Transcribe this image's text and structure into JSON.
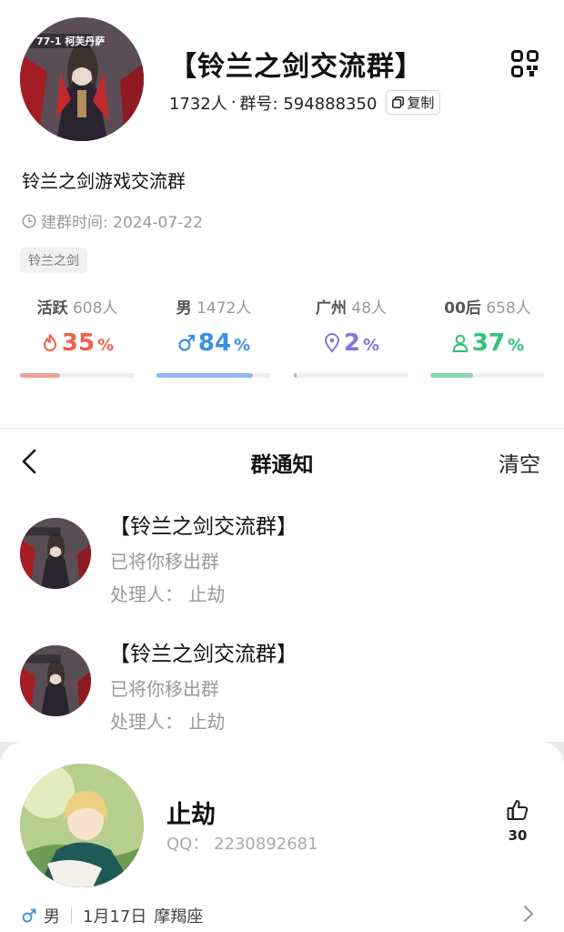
{
  "group": {
    "name": "【铃兰之剑交流群】",
    "member_count": "1732人",
    "separator": "·",
    "group_id_label": "群号: 594888350",
    "copy_label": "复制",
    "description": "铃兰之剑游戏交流群",
    "created_label": "建群时间: 2024-07-22",
    "tag": "铃兰之剑",
    "avatar_caption": "77-1 柯芙丹萨"
  },
  "stats": [
    {
      "name": "活跃",
      "count": "608人",
      "value": "35",
      "unit": "%",
      "fill": 0.35,
      "color": "#f0614c",
      "icon": "flame-icon"
    },
    {
      "name": "男",
      "count": "1472人",
      "value": "84",
      "unit": "%",
      "fill": 0.84,
      "color": "#3a8ee6",
      "icon": "male-icon"
    },
    {
      "name": "广州",
      "count": "48人",
      "value": "2",
      "unit": "%",
      "fill": 0.02,
      "color": "#8a73d6",
      "icon": "location-pin-icon"
    },
    {
      "name": "00后",
      "count": "658人",
      "value": "37",
      "unit": "%",
      "fill": 0.37,
      "color": "#2fc27a",
      "icon": "person-icon"
    }
  ],
  "notify": {
    "title": "群通知",
    "clear_label": "清空",
    "items": [
      {
        "group": "【铃兰之剑交流群】",
        "text": "已将你移出群",
        "handler": "处理人：  止劫"
      },
      {
        "group": "【铃兰之剑交流群】",
        "text": "已将你移出群",
        "handler": "处理人：  止劫"
      }
    ]
  },
  "profile": {
    "name": "止劫",
    "qq": "QQ：  2230892681",
    "likes": "30",
    "gender": "男",
    "birthday": "1月17日",
    "zodiac": "摩羯座"
  },
  "colors": {
    "active_red": "#f0614c",
    "male_blue": "#3a8ee6",
    "purple": "#8a73d6",
    "green": "#2fc27a",
    "muted_gray": "#999999"
  }
}
